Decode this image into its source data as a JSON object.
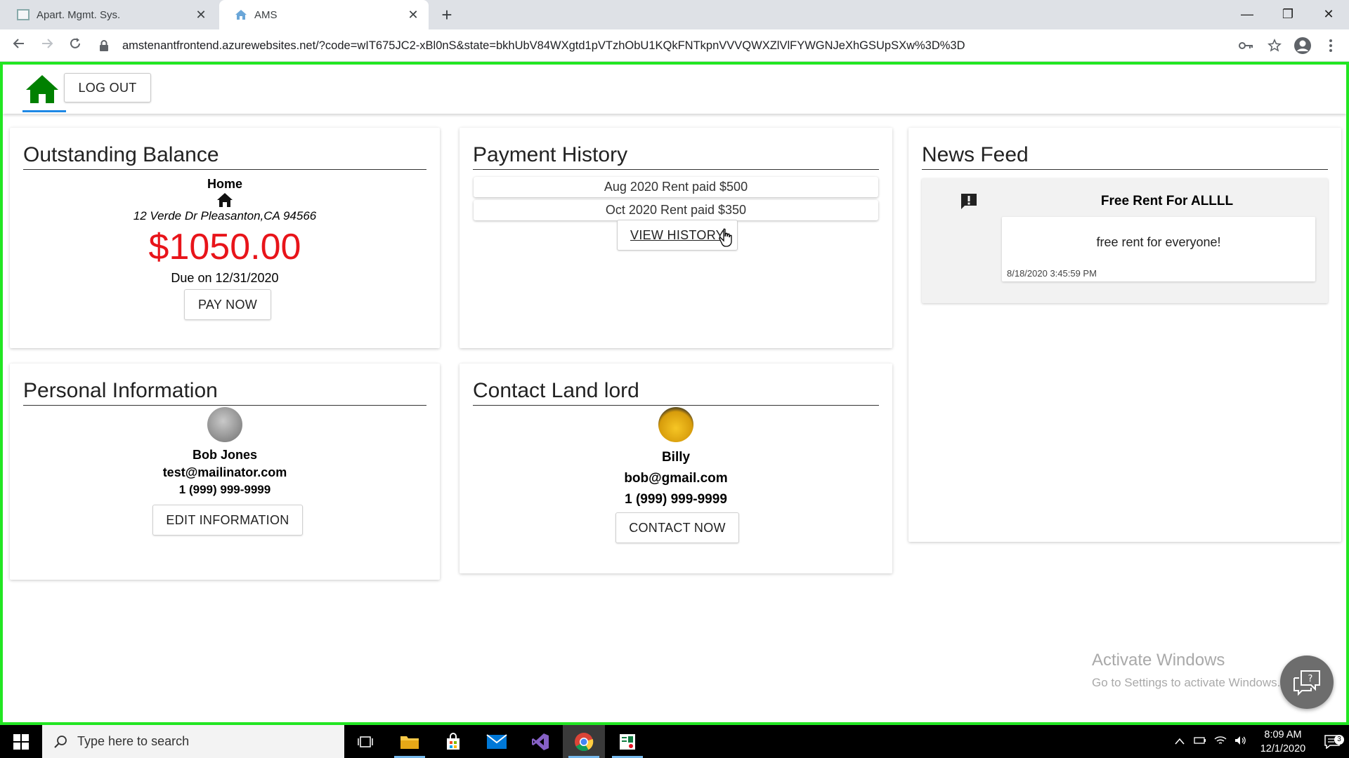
{
  "browser": {
    "tabs": [
      {
        "title": "Apart. Mgmt. Sys.",
        "close": "✕"
      },
      {
        "title": "AMS",
        "close": "✕"
      }
    ],
    "new_tab": "+",
    "url": "amstenantfrontend.azurewebsites.net/?code=wIT675JC2-xBl0nS&state=bkhUbV84WXgtd1pVTzhObU1KQkFNTkpnVVVQWXZlVlFYWGNJeXhGSUpSXw%3D%3D",
    "window_controls": {
      "minimize": "—",
      "restore": "❐",
      "close": "✕"
    }
  },
  "app": {
    "logout_label": "LOG OUT",
    "balance": {
      "title": "Outstanding Balance",
      "property_name": "Home",
      "address": "12 Verde Dr Pleasanton,CA 94566",
      "amount": "$1050.00",
      "due": "Due on 12/31/2020",
      "pay_label": "PAY NOW"
    },
    "payment_history": {
      "title": "Payment History",
      "items": [
        "Aug 2020 Rent paid $500",
        "Oct 2020 Rent paid $350"
      ],
      "view_label": "VIEW HISTORY"
    },
    "news": {
      "title": "News Feed",
      "items": [
        {
          "title": "Free Rent For ALLLL",
          "body": "free rent for everyone!",
          "time": "8/18/2020 3:45:59 PM"
        }
      ]
    },
    "personal": {
      "title": "Personal Information",
      "name": "Bob Jones",
      "email": "test@mailinator.com",
      "phone": "1 (999) 999-9999",
      "edit_label": "EDIT INFORMATION"
    },
    "contact": {
      "title": "Contact Land lord",
      "name": "Billy",
      "email": "bob@gmail.com",
      "phone": "1 (999) 999-9999",
      "contact_label": "CONTACT NOW"
    },
    "accent_color": "#008000",
    "amount_color": "#e8141a"
  },
  "watermark": {
    "line1": "Activate Windows",
    "line2": "Go to Settings to activate Windows."
  },
  "taskbar": {
    "search_placeholder": "Type here to search",
    "time": "8:09 AM",
    "date": "12/1/2020",
    "notification_count": "3",
    "icons": [
      "task-view-icon",
      "file-explorer-icon",
      "store-icon",
      "mail-icon",
      "visual-studio-icon",
      "chrome-icon",
      "app-icon"
    ]
  }
}
